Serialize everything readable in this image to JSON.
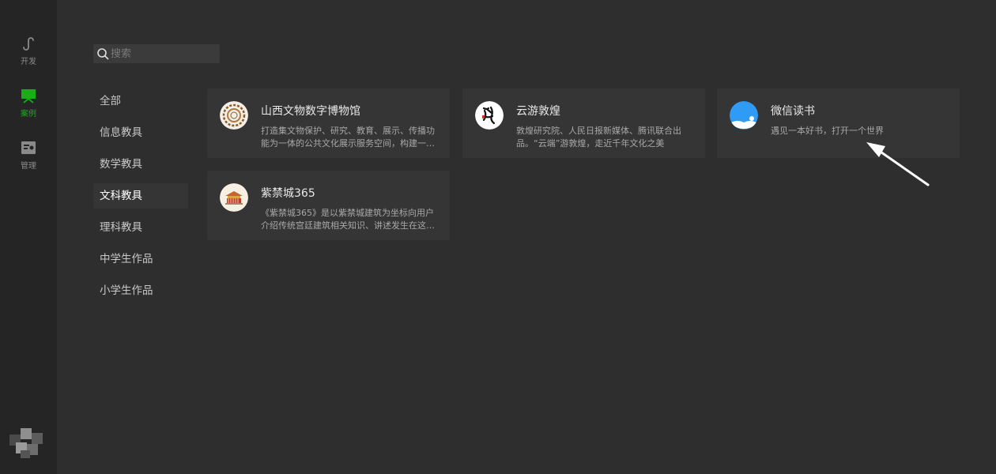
{
  "rail": {
    "items": [
      {
        "label": "开发",
        "icon": "mini-program-icon"
      },
      {
        "label": "案例",
        "icon": "showcase-icon"
      },
      {
        "label": "管理",
        "icon": "manage-icon"
      }
    ],
    "active_color": "#1aad19"
  },
  "search": {
    "placeholder": "搜索",
    "value": ""
  },
  "categories": [
    {
      "label": "全部"
    },
    {
      "label": "信息教具"
    },
    {
      "label": "数学教具"
    },
    {
      "label": "文科教具"
    },
    {
      "label": "理科教具"
    },
    {
      "label": "中学生作品"
    },
    {
      "label": "小学生作品"
    }
  ],
  "active_category": "文科教具",
  "cards": [
    {
      "title": "山西文物数字博物馆",
      "desc": "打造集文物保护、研究、教育、展示、传播功能为一体的公共文化展示服务空间，构建一…",
      "icon": "museum-logo-icon"
    },
    {
      "title": "云游敦煌",
      "desc": "敦煌研究院、人民日报新媒体、腾讯联合出品。“云端”游敦煌，走近千年文化之美",
      "icon": "dunhuang-logo-icon"
    },
    {
      "title": "微信读书",
      "desc": "遇见一本好书，打开一个世界",
      "icon": "wechat-read-logo-icon"
    },
    {
      "title": "紫禁城365",
      "desc": "《紫禁城365》是以紫禁城建筑为坐标向用户介绍传统宫廷建筑相关知识、讲述发生在这…",
      "icon": "forbidden-city-logo-icon"
    }
  ]
}
